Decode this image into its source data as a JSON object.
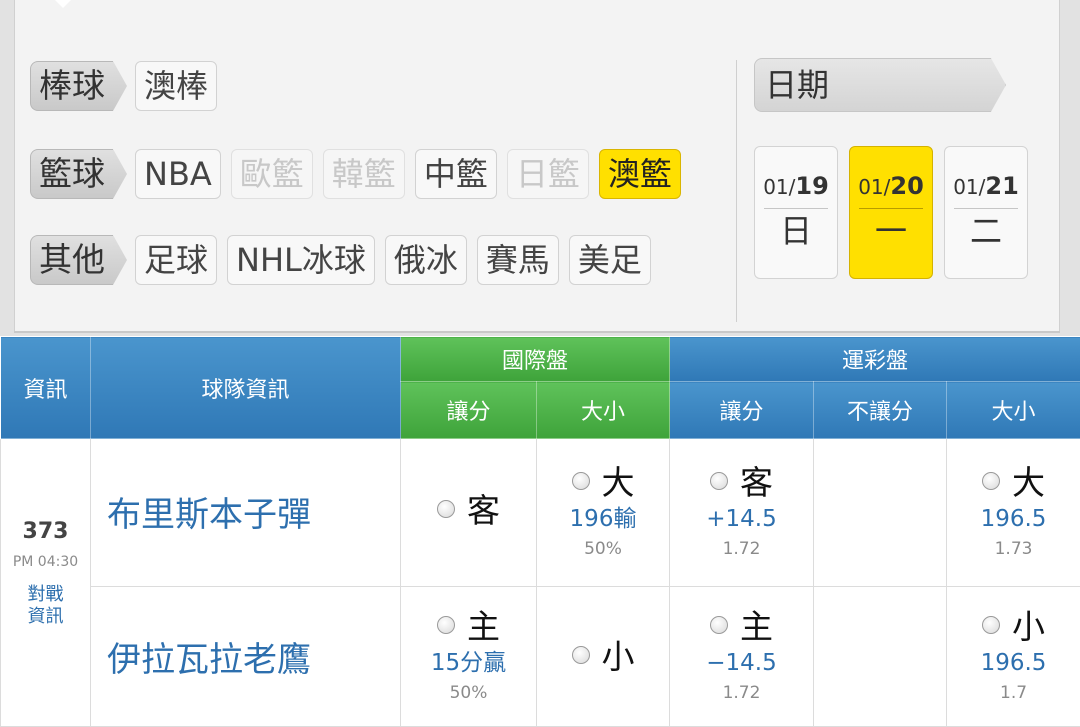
{
  "filters": {
    "rows": [
      {
        "category": "棒球",
        "tags": [
          {
            "label": "澳棒",
            "state": "normal"
          }
        ]
      },
      {
        "category": "籃球",
        "tags": [
          {
            "label": "NBA",
            "state": "normal"
          },
          {
            "label": "歐籃",
            "state": "disabled"
          },
          {
            "label": "韓籃",
            "state": "disabled"
          },
          {
            "label": "中籃",
            "state": "normal"
          },
          {
            "label": "日籃",
            "state": "disabled"
          },
          {
            "label": "澳籃",
            "state": "selected"
          }
        ]
      },
      {
        "category": "其他",
        "tags": [
          {
            "label": "足球",
            "state": "normal"
          },
          {
            "label": "NHL冰球",
            "state": "normal"
          },
          {
            "label": "俄冰",
            "state": "normal"
          },
          {
            "label": "賽馬",
            "state": "normal"
          },
          {
            "label": "美足",
            "state": "normal"
          }
        ]
      }
    ]
  },
  "date_picker": {
    "header": "日期",
    "dates": [
      {
        "month": "01/",
        "day": "19",
        "weekday": "日",
        "selected": false
      },
      {
        "month": "01/",
        "day": "20",
        "weekday": "一",
        "selected": true
      },
      {
        "month": "01/",
        "day": "21",
        "weekday": "二",
        "selected": false
      }
    ]
  },
  "table": {
    "headers": {
      "info": "資訊",
      "team_info": "球隊資訊",
      "intl": "國際盤",
      "sports_lottery": "運彩盤",
      "intl_spread": "讓分",
      "intl_total": "大小",
      "lottery_spread": "讓分",
      "lottery_moneyline": "不讓分",
      "lottery_total": "大小"
    },
    "game": {
      "number": "373",
      "time": "PM 04:30",
      "versus_line1": "對戰",
      "versus_line2": "資訊"
    },
    "away": {
      "team": "布里斯本子彈",
      "intl_spread_pick": "客",
      "intl_total_pick": "大",
      "intl_total_line": "196輸",
      "intl_total_pct": "50%",
      "lottery_spread_pick": "客",
      "lottery_spread_line": "+14.5",
      "lottery_spread_odds": "1.72",
      "lottery_total_pick": "大",
      "lottery_total_line": "196.5",
      "lottery_total_odds": "1.73"
    },
    "home": {
      "team": "伊拉瓦拉老鷹",
      "intl_spread_pick": "主",
      "intl_spread_line": "15分贏",
      "intl_spread_pct": "50%",
      "intl_total_pick": "小",
      "lottery_spread_pick": "主",
      "lottery_spread_line": "−14.5",
      "lottery_spread_odds": "1.72",
      "lottery_total_pick": "小",
      "lottery_total_line": "196.5",
      "lottery_total_odds": "1.7"
    }
  }
}
